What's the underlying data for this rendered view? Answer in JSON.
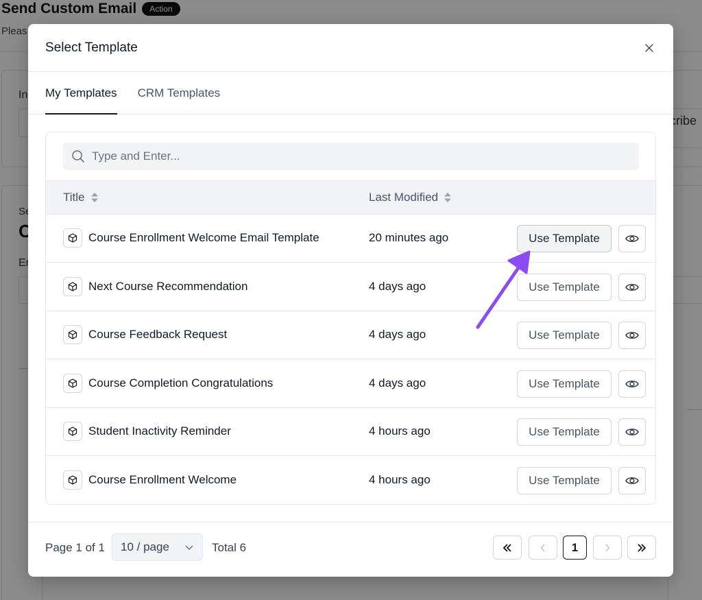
{
  "background": {
    "title": "Send Custom Email",
    "badge": "Action",
    "subtitle_fragment": "Pleas",
    "label_a": "In",
    "label_b": "Se",
    "label_c": "C",
    "label_d": "Er",
    "right_fragment": "scribe"
  },
  "modal": {
    "title": "Select Template",
    "close_icon": "close-icon"
  },
  "tabs": [
    {
      "label": "My Templates",
      "active": true
    },
    {
      "label": "CRM Templates",
      "active": false
    }
  ],
  "search": {
    "placeholder": "Type and Enter..."
  },
  "table": {
    "columns": [
      "Title",
      "Last Modified"
    ],
    "rows": [
      {
        "title": "Course Enrollment Welcome Email Template",
        "modified": "20 minutes ago",
        "action": "Use Template"
      },
      {
        "title": "Next Course Recommendation",
        "modified": "4 days ago",
        "action": "Use Template"
      },
      {
        "title": "Course Feedback Request",
        "modified": "4 days ago",
        "action": "Use Template"
      },
      {
        "title": "Course Completion Congratulations",
        "modified": "4 days ago",
        "action": "Use Template"
      },
      {
        "title": "Student Inactivity Reminder",
        "modified": "4 hours ago",
        "action": "Use Template"
      },
      {
        "title": "Course Enrollment Welcome",
        "modified": "4 hours ago",
        "action": "Use Template"
      }
    ]
  },
  "pagination": {
    "page_info": "Page 1 of 1",
    "per_page": "10 / page",
    "total": "Total 6",
    "current_page": "1"
  },
  "colors": {
    "annotation_arrow": "#8b4cf0"
  }
}
